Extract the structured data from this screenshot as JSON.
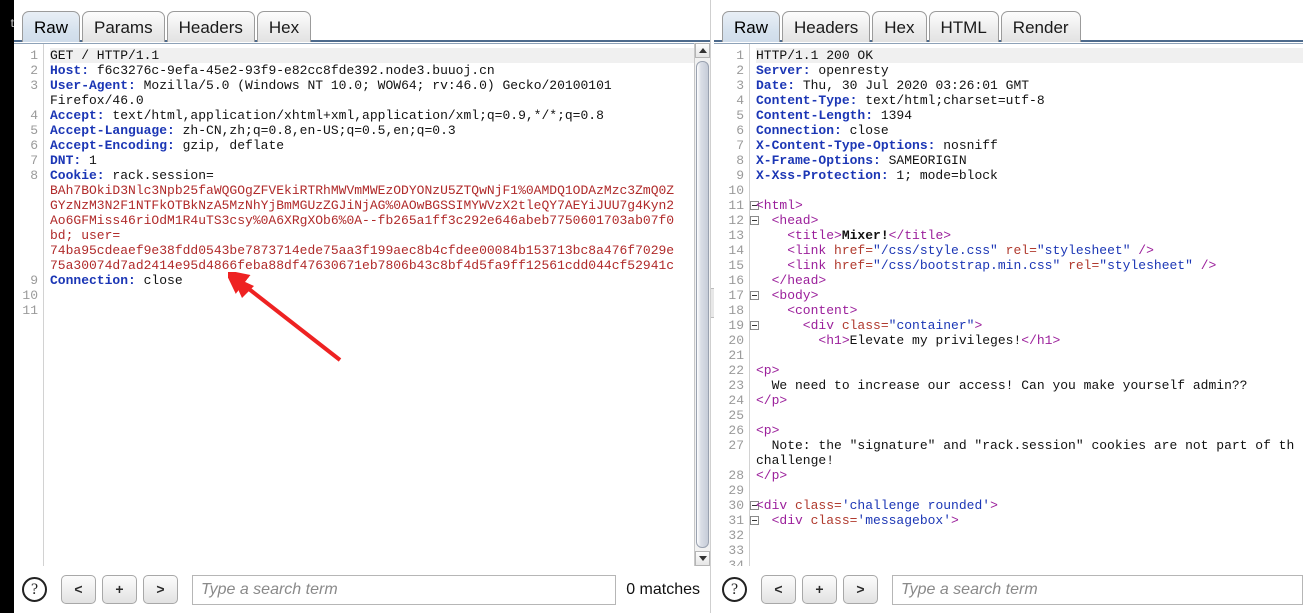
{
  "window": {
    "left_edge_label": "t"
  },
  "request_panel": {
    "name": "request",
    "tabs": [
      {
        "label": "Raw",
        "selected": true
      },
      {
        "label": "Params",
        "selected": false
      },
      {
        "label": "Headers",
        "selected": false
      },
      {
        "label": "Hex",
        "selected": false
      }
    ],
    "line_numbers": [
      "1",
      "2",
      "3",
      "",
      "4",
      "5",
      "6",
      "7",
      "8",
      "",
      "",
      "",
      "",
      "",
      "",
      "9",
      "10",
      "11"
    ],
    "lines": [
      {
        "n": "1",
        "segments": [
          {
            "t": "GET / HTTP/1.1",
            "c": "val"
          }
        ],
        "first": true
      },
      {
        "n": "2",
        "segments": [
          {
            "t": "Host:",
            "c": "hdr"
          },
          {
            "t": " f6c3276c-9efa-45e2-93f9-e82cc8fde392.node3.buuoj.cn",
            "c": "val"
          }
        ]
      },
      {
        "n": "3",
        "segments": [
          {
            "t": "User-Agent:",
            "c": "hdr"
          },
          {
            "t": " Mozilla/5.0 (Windows NT 10.0; WOW64; rv:46.0) Gecko/20100101",
            "c": "val"
          }
        ]
      },
      {
        "n": "",
        "segments": [
          {
            "t": "Firefox/46.0",
            "c": "val"
          }
        ]
      },
      {
        "n": "4",
        "segments": [
          {
            "t": "Accept:",
            "c": "hdr"
          },
          {
            "t": " text/html,application/xhtml+xml,application/xml;q=0.9,*/*;q=0.8",
            "c": "val"
          }
        ]
      },
      {
        "n": "5",
        "segments": [
          {
            "t": "Accept-Language:",
            "c": "hdr"
          },
          {
            "t": " zh-CN,zh;q=0.8,en-US;q=0.5,en;q=0.3",
            "c": "val"
          }
        ]
      },
      {
        "n": "6",
        "segments": [
          {
            "t": "Accept-Encoding:",
            "c": "hdr"
          },
          {
            "t": " gzip, deflate",
            "c": "val"
          }
        ]
      },
      {
        "n": "7",
        "segments": [
          {
            "t": "DNT:",
            "c": "hdr"
          },
          {
            "t": " 1",
            "c": "val"
          }
        ]
      },
      {
        "n": "8",
        "segments": [
          {
            "t": "Cookie:",
            "c": "hdr"
          },
          {
            "t": " rack.session=",
            "c": "val"
          }
        ]
      },
      {
        "n": "",
        "segments": [
          {
            "t": "BAh7BOkiD3Nlc3Npb25faWQGOgZFVEkiRTRhMWVmMWEzODYONzU5ZTQwNjF1%0AMDQ1ODAzMzc3ZmQ0Z",
            "c": "ck"
          }
        ]
      },
      {
        "n": "",
        "segments": [
          {
            "t": "GYzNzM3N2F1NTFkOTBkNzA5MzNhYjBmMGUzZGJiNjAG%0AOwBGSSIMYWVzX2tleQY7AEYiJUU7g4Kyn2",
            "c": "ck"
          }
        ]
      },
      {
        "n": "",
        "segments": [
          {
            "t": "Ao6GFMiss46riOdM1R4uTS3csy%0A6XRgXOb6%0A--fb265a1ff3c292e646abeb7750601703ab07f0",
            "c": "ck"
          }
        ]
      },
      {
        "n": "",
        "segments": [
          {
            "t": "bd; user=",
            "c": "ck"
          }
        ]
      },
      {
        "n": "",
        "segments": [
          {
            "t": "74ba95cdeaef9e38fdd0543be7873714ede75aa3f199aec8b4cfdee00084b153713bc8a476f7029e",
            "c": "ck"
          }
        ]
      },
      {
        "n": "",
        "segments": [
          {
            "t": "75a30074d7ad2414e95d4866feba88df47630671eb7806b43c8bf4d5fa9ff12561cdd044cf52941c",
            "c": "ck"
          }
        ]
      },
      {
        "n": "9",
        "segments": [
          {
            "t": "Connection:",
            "c": "hdr"
          },
          {
            "t": " close",
            "c": "val"
          }
        ]
      },
      {
        "n": "10",
        "segments": []
      },
      {
        "n": "11",
        "segments": []
      }
    ],
    "search": {
      "help_label": "?",
      "prev_label": "<",
      "add_label": "+",
      "next_label": ">",
      "placeholder": "Type a search term",
      "value": "",
      "matches_label": "0 matches"
    }
  },
  "response_panel": {
    "name": "response",
    "tabs": [
      {
        "label": "Raw",
        "selected": true
      },
      {
        "label": "Headers",
        "selected": false
      },
      {
        "label": "Hex",
        "selected": false
      },
      {
        "label": "HTML",
        "selected": false
      },
      {
        "label": "Render",
        "selected": false
      }
    ],
    "lines": [
      {
        "n": "1",
        "fold": false,
        "segments": [
          {
            "t": "HTTP/1.1 200 OK",
            "c": "val"
          }
        ],
        "first": true
      },
      {
        "n": "2",
        "fold": false,
        "segments": [
          {
            "t": "Server:",
            "c": "hdr"
          },
          {
            "t": " openresty",
            "c": "val"
          }
        ]
      },
      {
        "n": "3",
        "fold": false,
        "segments": [
          {
            "t": "Date:",
            "c": "hdr"
          },
          {
            "t": " Thu, 30 Jul 2020 03:26:01 GMT",
            "c": "val"
          }
        ]
      },
      {
        "n": "4",
        "fold": false,
        "segments": [
          {
            "t": "Content-Type:",
            "c": "hdr"
          },
          {
            "t": " text/html;charset=utf-8",
            "c": "val"
          }
        ]
      },
      {
        "n": "5",
        "fold": false,
        "segments": [
          {
            "t": "Content-Length:",
            "c": "hdr"
          },
          {
            "t": " 1394",
            "c": "val"
          }
        ]
      },
      {
        "n": "6",
        "fold": false,
        "segments": [
          {
            "t": "Connection:",
            "c": "hdr"
          },
          {
            "t": " close",
            "c": "val"
          }
        ]
      },
      {
        "n": "7",
        "fold": false,
        "segments": [
          {
            "t": "X-Content-Type-Options:",
            "c": "hdr"
          },
          {
            "t": " nosniff",
            "c": "val"
          }
        ]
      },
      {
        "n": "8",
        "fold": false,
        "segments": [
          {
            "t": "X-Frame-Options:",
            "c": "hdr"
          },
          {
            "t": " SAMEORIGIN",
            "c": "val"
          }
        ]
      },
      {
        "n": "9",
        "fold": false,
        "segments": [
          {
            "t": "X-Xss-Protection:",
            "c": "hdr"
          },
          {
            "t": " 1; mode=block",
            "c": "val"
          }
        ]
      },
      {
        "n": "10",
        "fold": false,
        "segments": []
      },
      {
        "n": "11",
        "fold": true,
        "segments": [
          {
            "t": "<html>",
            "c": "tag"
          }
        ]
      },
      {
        "n": "12",
        "fold": true,
        "segments": [
          {
            "t": "  <head>",
            "c": "tag"
          }
        ]
      },
      {
        "n": "13",
        "fold": false,
        "segments": [
          {
            "t": "    <title>",
            "c": "tag"
          },
          {
            "t": "Mixer!",
            "c": "bold"
          },
          {
            "t": "</title>",
            "c": "tag"
          }
        ]
      },
      {
        "n": "14",
        "fold": false,
        "segments": [
          {
            "t": "    <link ",
            "c": "tag"
          },
          {
            "t": "href=",
            "c": "attr"
          },
          {
            "t": "\"/css/style.css\"",
            "c": "str"
          },
          {
            "t": " rel=",
            "c": "attr"
          },
          {
            "t": "\"stylesheet\"",
            "c": "str"
          },
          {
            "t": " />",
            "c": "tag"
          }
        ]
      },
      {
        "n": "15",
        "fold": false,
        "segments": [
          {
            "t": "    <link ",
            "c": "tag"
          },
          {
            "t": "href=",
            "c": "attr"
          },
          {
            "t": "\"/css/bootstrap.min.css\"",
            "c": "str"
          },
          {
            "t": " rel=",
            "c": "attr"
          },
          {
            "t": "\"stylesheet\"",
            "c": "str"
          },
          {
            "t": " />",
            "c": "tag"
          }
        ]
      },
      {
        "n": "16",
        "fold": false,
        "segments": [
          {
            "t": "  </head>",
            "c": "tag"
          }
        ]
      },
      {
        "n": "17",
        "fold": true,
        "segments": [
          {
            "t": "  <body>",
            "c": "tag"
          }
        ]
      },
      {
        "n": "18",
        "fold": false,
        "segments": [
          {
            "t": "    <content>",
            "c": "tag"
          }
        ]
      },
      {
        "n": "19",
        "fold": true,
        "segments": [
          {
            "t": "      <div ",
            "c": "tag"
          },
          {
            "t": "class=",
            "c": "attr"
          },
          {
            "t": "\"container\"",
            "c": "str"
          },
          {
            "t": ">",
            "c": "tag"
          }
        ]
      },
      {
        "n": "20",
        "fold": false,
        "segments": [
          {
            "t": "        <h1>",
            "c": "tag"
          },
          {
            "t": "Elevate my privileges!",
            "c": "txt"
          },
          {
            "t": "</h1>",
            "c": "tag"
          }
        ]
      },
      {
        "n": "21",
        "fold": false,
        "segments": []
      },
      {
        "n": "22",
        "fold": false,
        "segments": [
          {
            "t": "<p>",
            "c": "tag"
          }
        ]
      },
      {
        "n": "23",
        "fold": false,
        "segments": [
          {
            "t": "  We need to increase our access! Can you make yourself admin??",
            "c": "txt"
          }
        ]
      },
      {
        "n": "24",
        "fold": false,
        "segments": [
          {
            "t": "</p>",
            "c": "tag"
          }
        ]
      },
      {
        "n": "25",
        "fold": false,
        "segments": []
      },
      {
        "n": "26",
        "fold": false,
        "segments": [
          {
            "t": "<p>",
            "c": "tag"
          }
        ]
      },
      {
        "n": "27",
        "fold": false,
        "segments": [
          {
            "t": "  Note: the \"signature\" and \"rack.session\" cookies are not part of th",
            "c": "txt"
          }
        ]
      },
      {
        "n": "",
        "fold": false,
        "segments": [
          {
            "t": "challenge!",
            "c": "txt"
          }
        ]
      },
      {
        "n": "28",
        "fold": false,
        "segments": [
          {
            "t": "</p>",
            "c": "tag"
          }
        ]
      },
      {
        "n": "29",
        "fold": false,
        "segments": []
      },
      {
        "n": "30",
        "fold": true,
        "segments": [
          {
            "t": "<div ",
            "c": "tag"
          },
          {
            "t": "class=",
            "c": "attr"
          },
          {
            "t": "'challenge rounded'",
            "c": "str"
          },
          {
            "t": ">",
            "c": "tag"
          }
        ]
      },
      {
        "n": "31",
        "fold": true,
        "segments": [
          {
            "t": "  <div ",
            "c": "tag"
          },
          {
            "t": "class=",
            "c": "attr"
          },
          {
            "t": "'messagebox'",
            "c": "str"
          },
          {
            "t": ">",
            "c": "tag"
          }
        ]
      },
      {
        "n": "32",
        "fold": false,
        "segments": []
      },
      {
        "n": "33",
        "fold": false,
        "segments": []
      },
      {
        "n": "34",
        "fold": false,
        "segments": []
      }
    ],
    "search": {
      "help_label": "?",
      "prev_label": "<",
      "add_label": "+",
      "next_label": ">",
      "placeholder": "Type a search term",
      "value": ""
    }
  },
  "annotation": {
    "arrow_color": "#ee2222",
    "name": "red-pointer-arrow"
  }
}
